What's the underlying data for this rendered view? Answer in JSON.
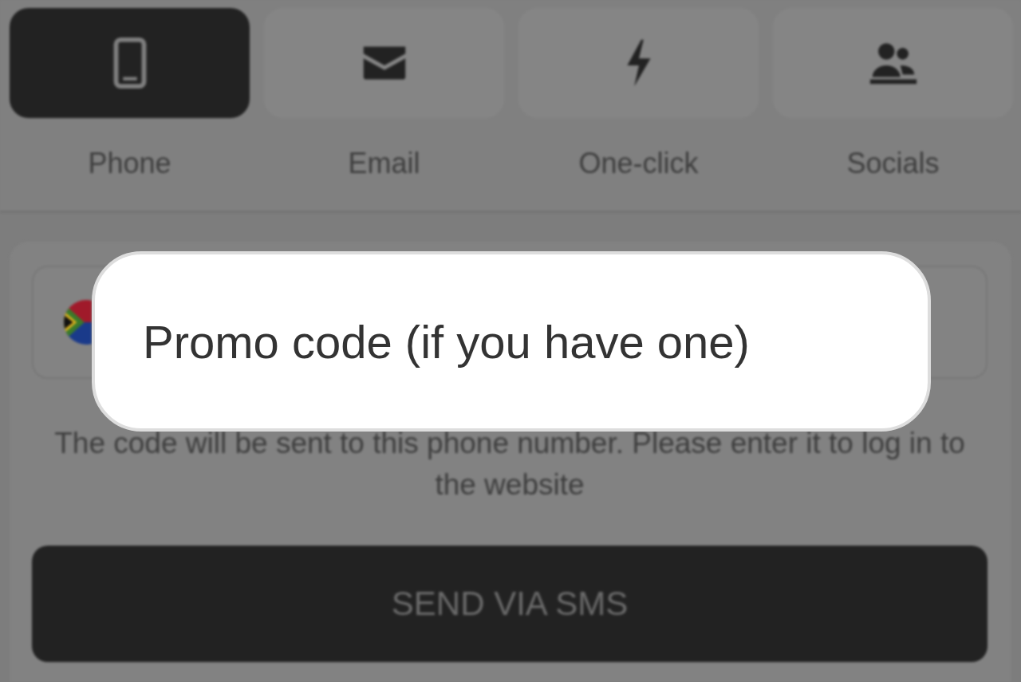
{
  "tabs": [
    {
      "label": "Phone",
      "selected": true
    },
    {
      "label": "Email",
      "selected": false
    },
    {
      "label": "One-click",
      "selected": false
    },
    {
      "label": "Socials",
      "selected": false
    }
  ],
  "hint": "The code will be sent to this phone number. Please enter it to log in to the website",
  "send_button": "SEND VIA SMS",
  "promo_field": {
    "placeholder": "Promo code (if you have one)"
  }
}
